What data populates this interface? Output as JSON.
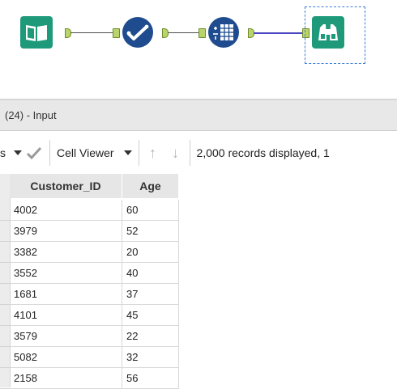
{
  "workflow": {
    "tools": [
      {
        "name": "input-data-tool",
        "icon": "open-book-icon",
        "color": "#1e9a7a"
      },
      {
        "name": "select-tool",
        "icon": "checkmark-icon",
        "color": "#1f4c8f"
      },
      {
        "name": "formula-tool",
        "icon": "formula-grid-icon",
        "color": "#1f4c8f"
      },
      {
        "name": "browse-tool",
        "icon": "binoculars-icon",
        "color": "#1e9a7a",
        "selected": true
      }
    ]
  },
  "results": {
    "title": "(24) - Input",
    "toolbar": {
      "fields_label_partial": "s",
      "cell_viewer_label": "Cell Viewer",
      "status_text": "2,000 records displayed, 1"
    },
    "columns": [
      "Customer_ID",
      "Age"
    ],
    "rows": [
      [
        "4002",
        "60"
      ],
      [
        "3979",
        "52"
      ],
      [
        "3382",
        "20"
      ],
      [
        "3552",
        "40"
      ],
      [
        "1681",
        "37"
      ],
      [
        "4101",
        "45"
      ],
      [
        "3579",
        "22"
      ],
      [
        "5082",
        "32"
      ],
      [
        "2158",
        "56"
      ]
    ]
  },
  "colors": {
    "teal_tool": "#1e9a7a",
    "navy_tool": "#1f4c8f",
    "anchor_green": "#b9d46a",
    "selected_connection": "#4b44c2",
    "selection_outline": "#3f7fd8"
  }
}
